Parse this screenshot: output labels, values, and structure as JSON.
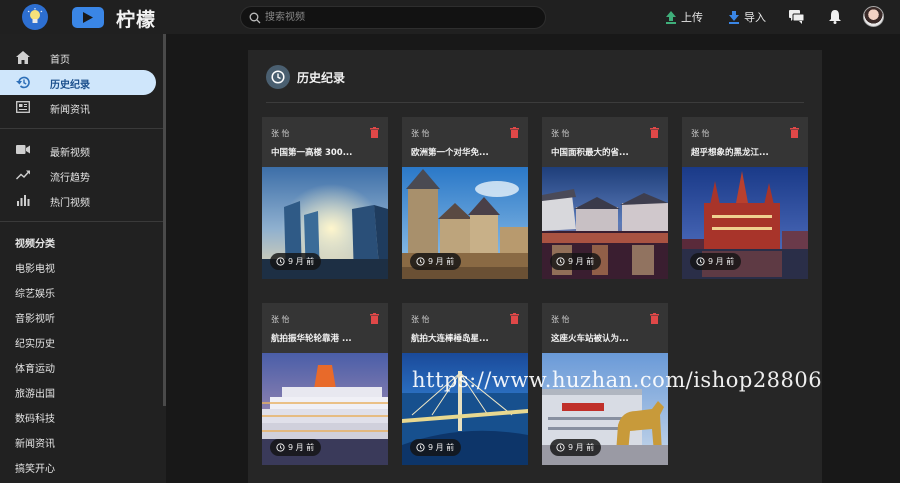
{
  "brand": {
    "name": "柠檬"
  },
  "header": {
    "search_placeholder": "搜索视频",
    "upload_label": "上传",
    "import_label": "导入",
    "accent": "#3a86e6"
  },
  "sidebar": {
    "main_nav": [
      {
        "label": "首页",
        "icon": "home-icon",
        "active": false
      },
      {
        "label": "历史纪录",
        "icon": "history-icon",
        "active": true
      },
      {
        "label": "新闻资讯",
        "icon": "news-icon",
        "active": false
      }
    ],
    "video_nav": [
      {
        "label": "最新视频",
        "icon": "video-camera-icon"
      },
      {
        "label": "流行趋势",
        "icon": "trending-icon"
      },
      {
        "label": "热门视频",
        "icon": "bar-chart-icon"
      }
    ],
    "category_heading": "视频分类",
    "categories": [
      "电影电视",
      "综艺娱乐",
      "音影视听",
      "纪实历史",
      "体育运动",
      "旅游出国",
      "数码科技",
      "新闻资讯",
      "搞笑开心"
    ]
  },
  "main": {
    "title": "历史纪录",
    "cards": [
      {
        "author": "张 怡",
        "title": "中国第一高楼 300...",
        "time": "9 月 前"
      },
      {
        "author": "张 怡",
        "title": "欧洲第一个对华免...",
        "time": "9 月 前"
      },
      {
        "author": "张 怡",
        "title": "中国面积最大的省...",
        "time": "9 月 前"
      },
      {
        "author": "张 怡",
        "title": "超乎想象的黑龙江...",
        "time": "9 月 前"
      },
      {
        "author": "张 怡",
        "title": "航拍振华轮轮靠港 ...",
        "time": "9 月 前"
      },
      {
        "author": "张 怡",
        "title": "航拍大连棒棰岛星...",
        "time": "9 月 前"
      },
      {
        "author": "张 怡",
        "title": "这座火车站被认为...",
        "time": "9 月 前"
      }
    ]
  },
  "watermark": "https://www.huzhan.com/ishop28806"
}
